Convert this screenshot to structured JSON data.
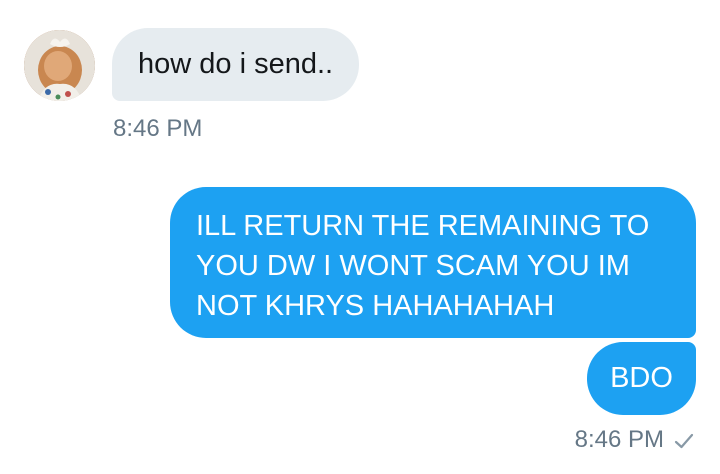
{
  "messages": {
    "incoming": {
      "text": "how do i send..",
      "time": "8:46 PM"
    },
    "outgoing": {
      "text_lines": [
        "ILL RETURN THE REMAINING TO",
        "YOU DW I WONT SCAM YOU IM",
        "NOT KHRYS HAHAHAHAH"
      ],
      "second_text": "BDO",
      "time": "8:46 PM",
      "status_icon": "check-icon"
    }
  },
  "colors": {
    "outgoing_bubble": "#1da1f2",
    "incoming_bubble": "#e6ecf0",
    "timestamp": "#657786"
  }
}
